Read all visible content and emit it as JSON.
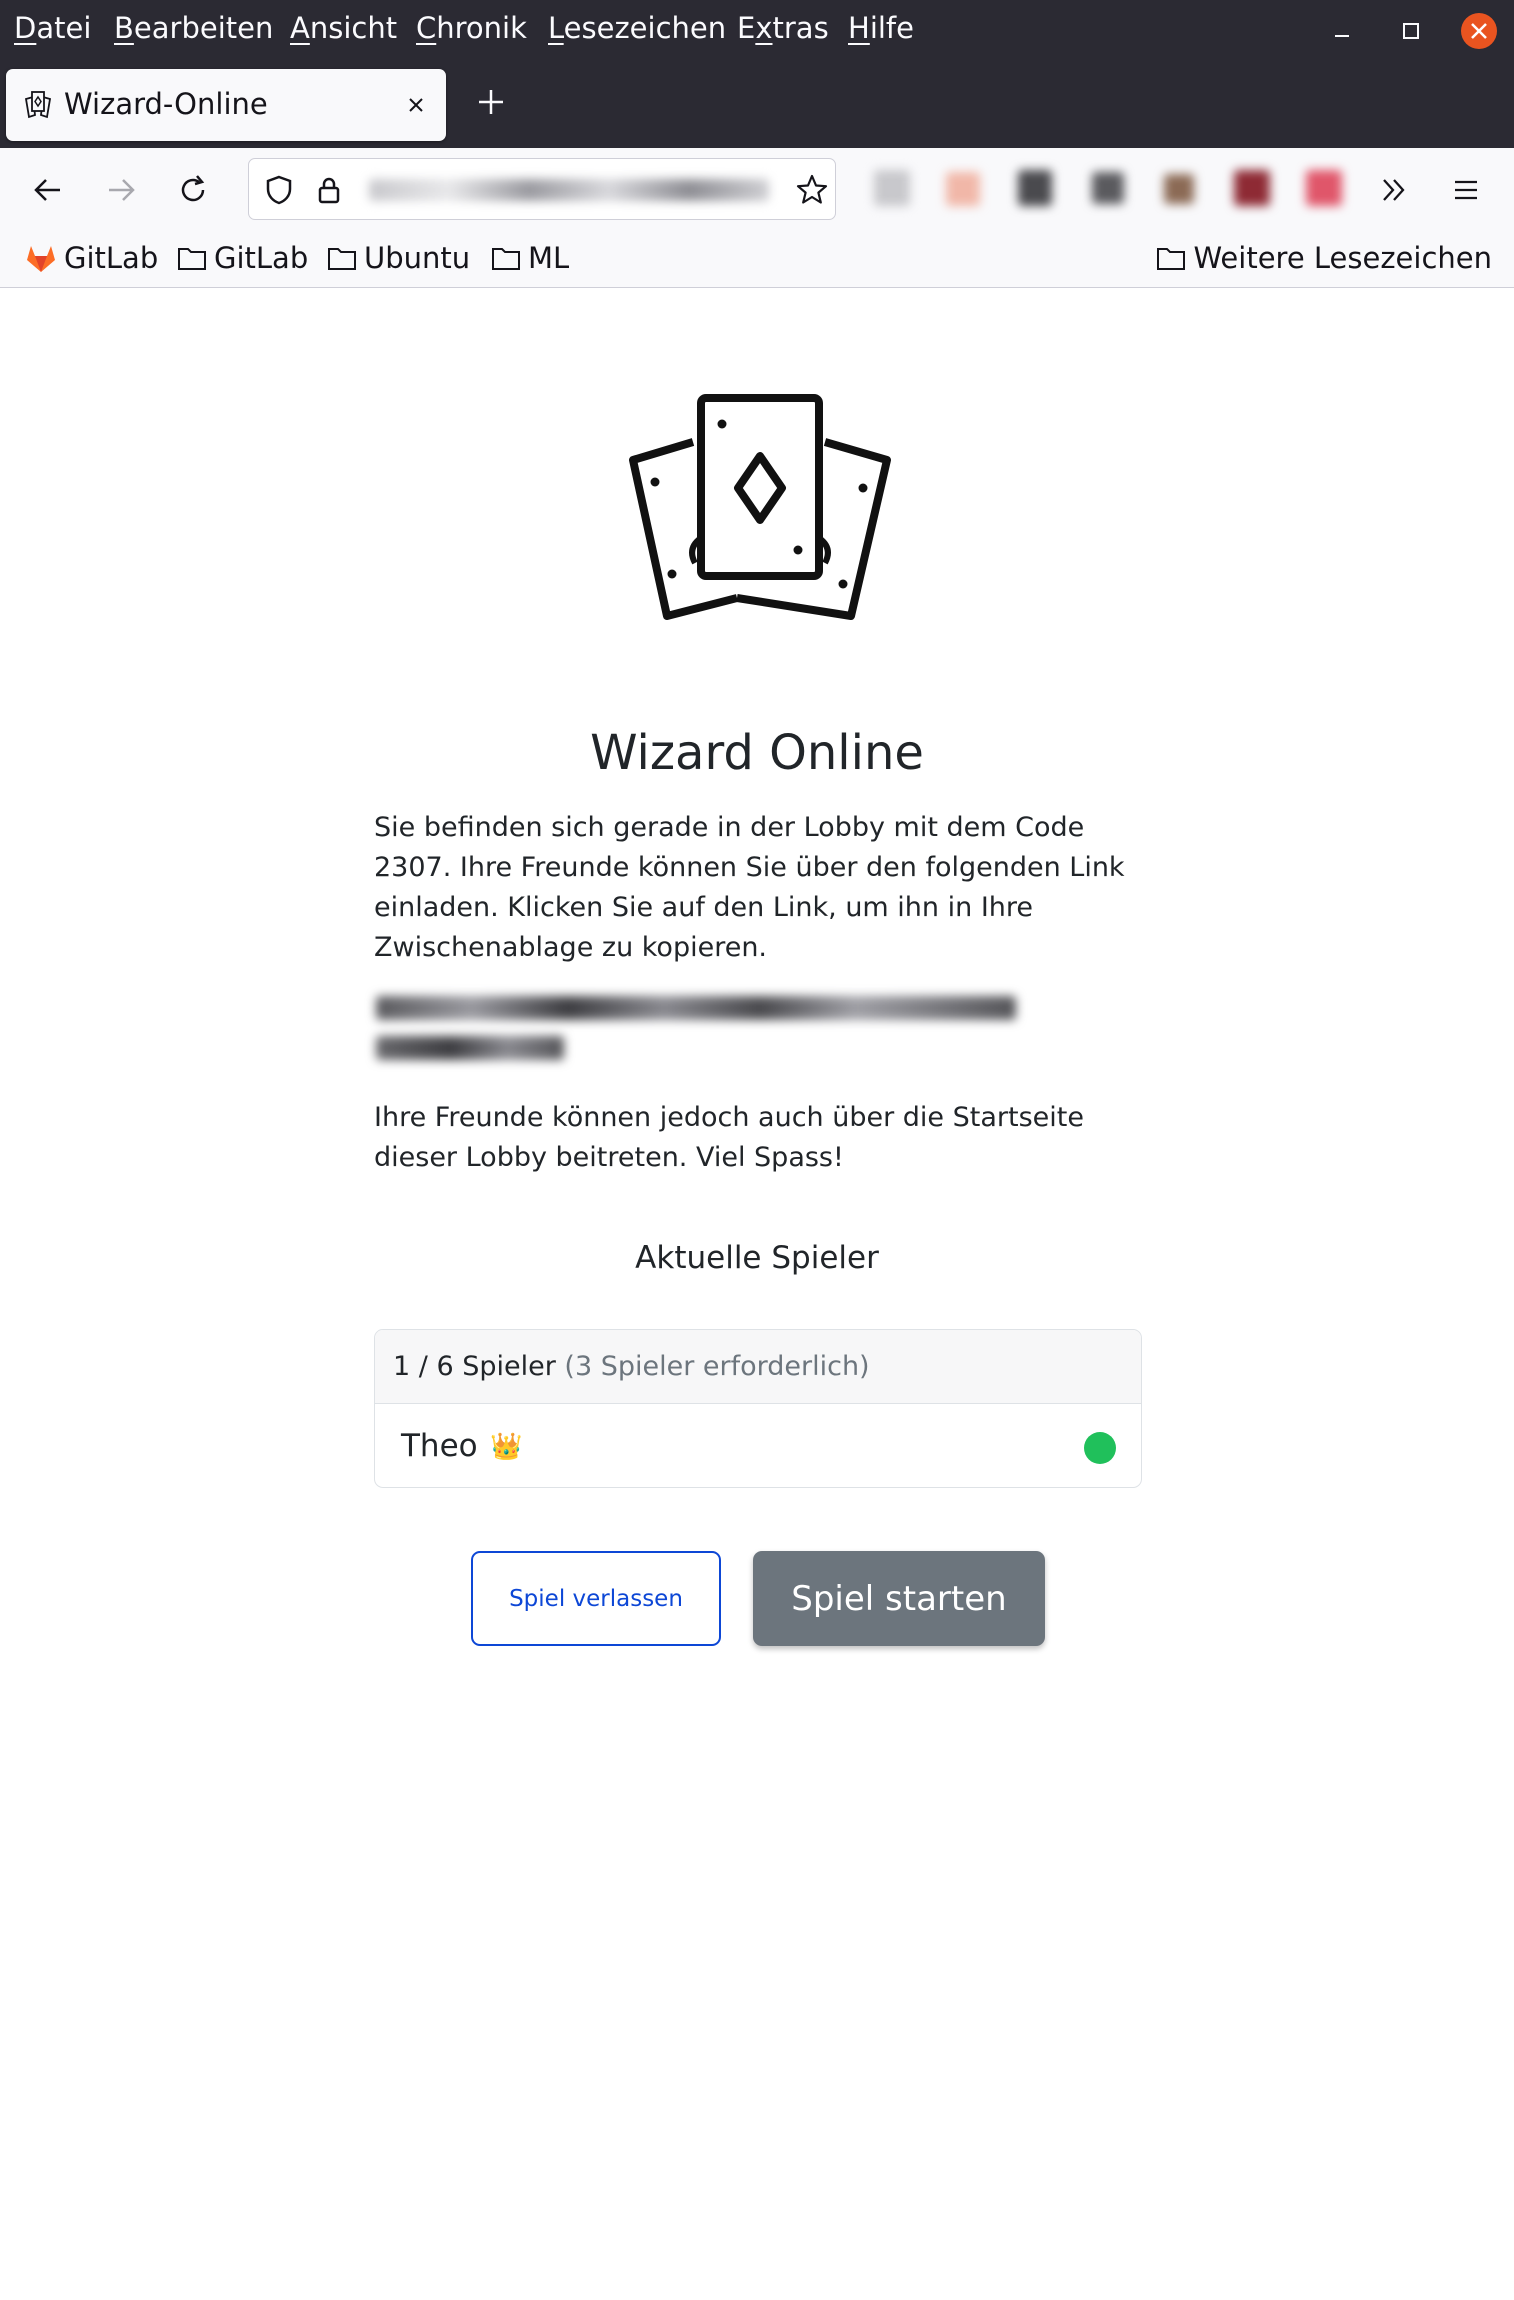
{
  "menubar": {
    "items": [
      {
        "acc": "D",
        "rest": "atei"
      },
      {
        "acc": "B",
        "rest": "earbeiten"
      },
      {
        "acc": "A",
        "rest": "nsicht"
      },
      {
        "acc": "C",
        "rest": "hronik"
      },
      {
        "acc": "L",
        "rest": "esezeichen"
      },
      {
        "pre": "E",
        "acc": "x",
        "rest": "tras"
      },
      {
        "acc": "H",
        "rest": "ilfe"
      }
    ]
  },
  "tab": {
    "title": "Wizard-Online"
  },
  "bookmarks": {
    "items": [
      "GitLab",
      "GitLab",
      "Ubuntu",
      "ML"
    ],
    "other": "Weitere Lesezeichen"
  },
  "page": {
    "title": "Wizard Online",
    "intro": "Sie befinden sich gerade in der Lobby mit dem Code 2307. Ihre Freunde können Sie über den folgenden Link einladen. Klicken Sie auf den Link, um ihn in Ihre Zwischenablage zu kopieren.",
    "outro": "Ihre Freunde können jedoch auch über die Startseite dieser Lobby beitreten. Viel Spass!",
    "players_heading": "Aktuelle Spieler",
    "player_count": "1 / 6 Spieler",
    "player_required": "(3 Spieler erforderlich)",
    "players": [
      {
        "name": "Theo",
        "badge": "👑",
        "status": "online",
        "status_color": "#20c05b"
      }
    ],
    "leave_button": "Spiel verlassen",
    "start_button": "Spiel starten"
  },
  "colors": {
    "chrome_dark": "#2b2a33",
    "toolbar": "#f9f9fb",
    "accent_blue": "#0d47d6",
    "start_button": "#6c757d",
    "close_button": "#e95420"
  }
}
